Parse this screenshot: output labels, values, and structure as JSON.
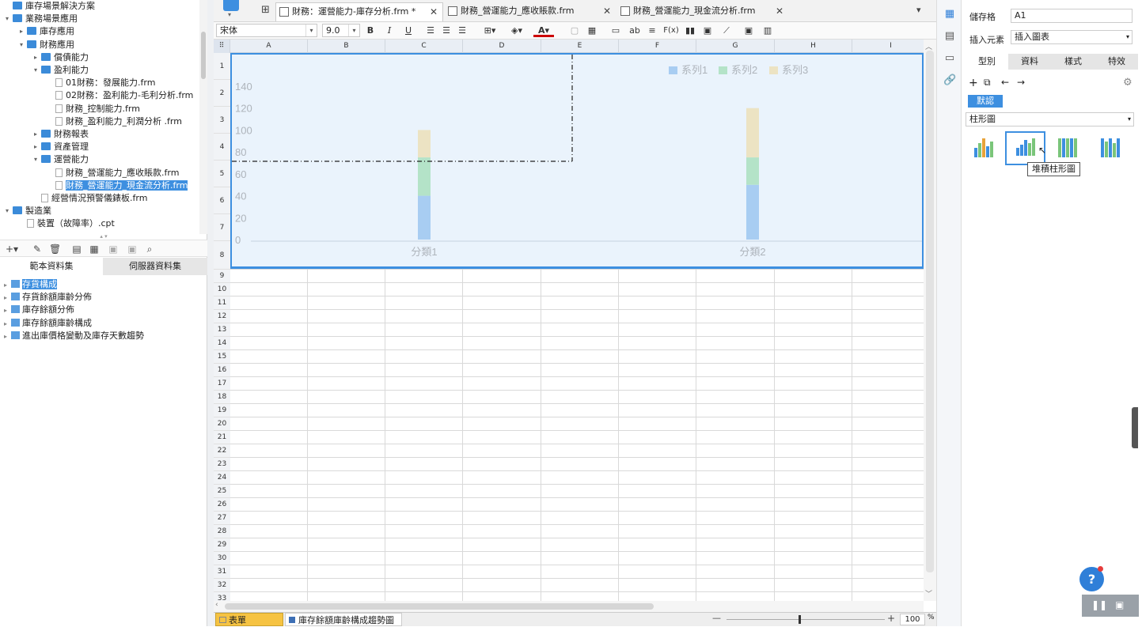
{
  "tree": [
    {
      "label": "庫存場景解決方案",
      "indent": 0,
      "type": "folder",
      "arrow": ""
    },
    {
      "label": "業務場景應用",
      "indent": 0,
      "type": "folder",
      "arrow": "▾"
    },
    {
      "label": "庫存應用",
      "indent": 1,
      "type": "folder",
      "arrow": "▸"
    },
    {
      "label": "財務應用",
      "indent": 1,
      "type": "folder",
      "arrow": "▾"
    },
    {
      "label": "償債能力",
      "indent": 2,
      "type": "folder",
      "arrow": "▸"
    },
    {
      "label": "盈利能力",
      "indent": 2,
      "type": "folder",
      "arrow": "▾"
    },
    {
      "label": "01財務：發展能力.frm",
      "indent": 3,
      "type": "file",
      "arrow": ""
    },
    {
      "label": "02財務：盈利能力-毛利分析.frm",
      "indent": 3,
      "type": "file",
      "arrow": ""
    },
    {
      "label": "財務_控制能力.frm",
      "indent": 3,
      "type": "file",
      "arrow": ""
    },
    {
      "label": "財務_盈利能力_利潤分析 .frm",
      "indent": 3,
      "type": "file",
      "arrow": ""
    },
    {
      "label": "財務報表",
      "indent": 2,
      "type": "folder",
      "arrow": "▸"
    },
    {
      "label": "資產管理",
      "indent": 2,
      "type": "folder",
      "arrow": "▸"
    },
    {
      "label": "運營能力",
      "indent": 2,
      "type": "folder",
      "arrow": "▾"
    },
    {
      "label": "財務_營運能力_應收賬款.frm",
      "indent": 3,
      "type": "file",
      "arrow": ""
    },
    {
      "label": "財務_營運能力_現金流分析.frm",
      "indent": 3,
      "type": "file",
      "arrow": "",
      "selected": true
    },
    {
      "label": "經營情況預警儀錶板.frm",
      "indent": 2,
      "type": "file",
      "arrow": ""
    },
    {
      "label": "製造業",
      "indent": 0,
      "type": "folder",
      "arrow": "▾"
    },
    {
      "label": "裝置（故障率）.cpt",
      "indent": 1,
      "type": "file",
      "arrow": ""
    }
  ],
  "dataset_tabs": [
    "範本資料集",
    "伺服器資料集"
  ],
  "datasets": [
    "存貨構成",
    "存貨餘額庫齡分佈",
    "庫存餘額分佈",
    "庫存餘額庫齡構成",
    "進出庫價格變動及庫存天數趨勢"
  ],
  "tabs": [
    {
      "label": "財務：運營能力-庫存分析.frm *"
    },
    {
      "label": "財務_營運能力_應收賬款.frm"
    },
    {
      "label": "財務_營運能力_現金流分析.frm"
    }
  ],
  "toolbar": {
    "font": "宋体",
    "size": "9.0",
    "bold": "B",
    "italic": "I",
    "underline": "U",
    "ab": "ab",
    "fx": "F(x)"
  },
  "columns": [
    "A",
    "B",
    "C",
    "D",
    "E",
    "F",
    "G",
    "H",
    "I"
  ],
  "rows": [
    "1",
    "2",
    "3",
    "4",
    "5",
    "6",
    "7",
    "8",
    "9",
    "10",
    "11",
    "12",
    "13",
    "14",
    "15",
    "16",
    "17",
    "18",
    "19",
    "20",
    "21",
    "22",
    "23",
    "24",
    "25",
    "26",
    "27",
    "28",
    "29",
    "30",
    "31",
    "32",
    "33"
  ],
  "chart_data": {
    "type": "bar",
    "stacked": true,
    "categories": [
      "分類1",
      "分類2"
    ],
    "series": [
      {
        "name": "系列1",
        "values": [
          40,
          50
        ],
        "color": "#a8cdf2"
      },
      {
        "name": "系列2",
        "values": [
          35,
          25
        ],
        "color": "#b4e3c8"
      },
      {
        "name": "系列3",
        "values": [
          25,
          45
        ],
        "color": "#ece3c3"
      }
    ],
    "ylim": [
      0,
      140
    ],
    "yticks": [
      "0",
      "20",
      "40",
      "60",
      "80",
      "100",
      "120",
      "140"
    ],
    "legend": "top-right"
  },
  "sheets": [
    {
      "label": "表單"
    },
    {
      "label": "庫存餘額庫齡構成趨勢圖"
    }
  ],
  "zoom": {
    "minus": "—",
    "plus": "+",
    "value": "100",
    "unit": "%"
  },
  "right": {
    "cell_label": "儲存格",
    "cell_value": "A1",
    "insert_label": "插入元素",
    "insert_value": "插入圖表",
    "tabs": [
      "型別",
      "資料",
      "樣式",
      "特效"
    ],
    "default_btn": "默認",
    "chart_type": "柱形圖",
    "tooltip": "堆積柱形圖"
  },
  "help": "?"
}
